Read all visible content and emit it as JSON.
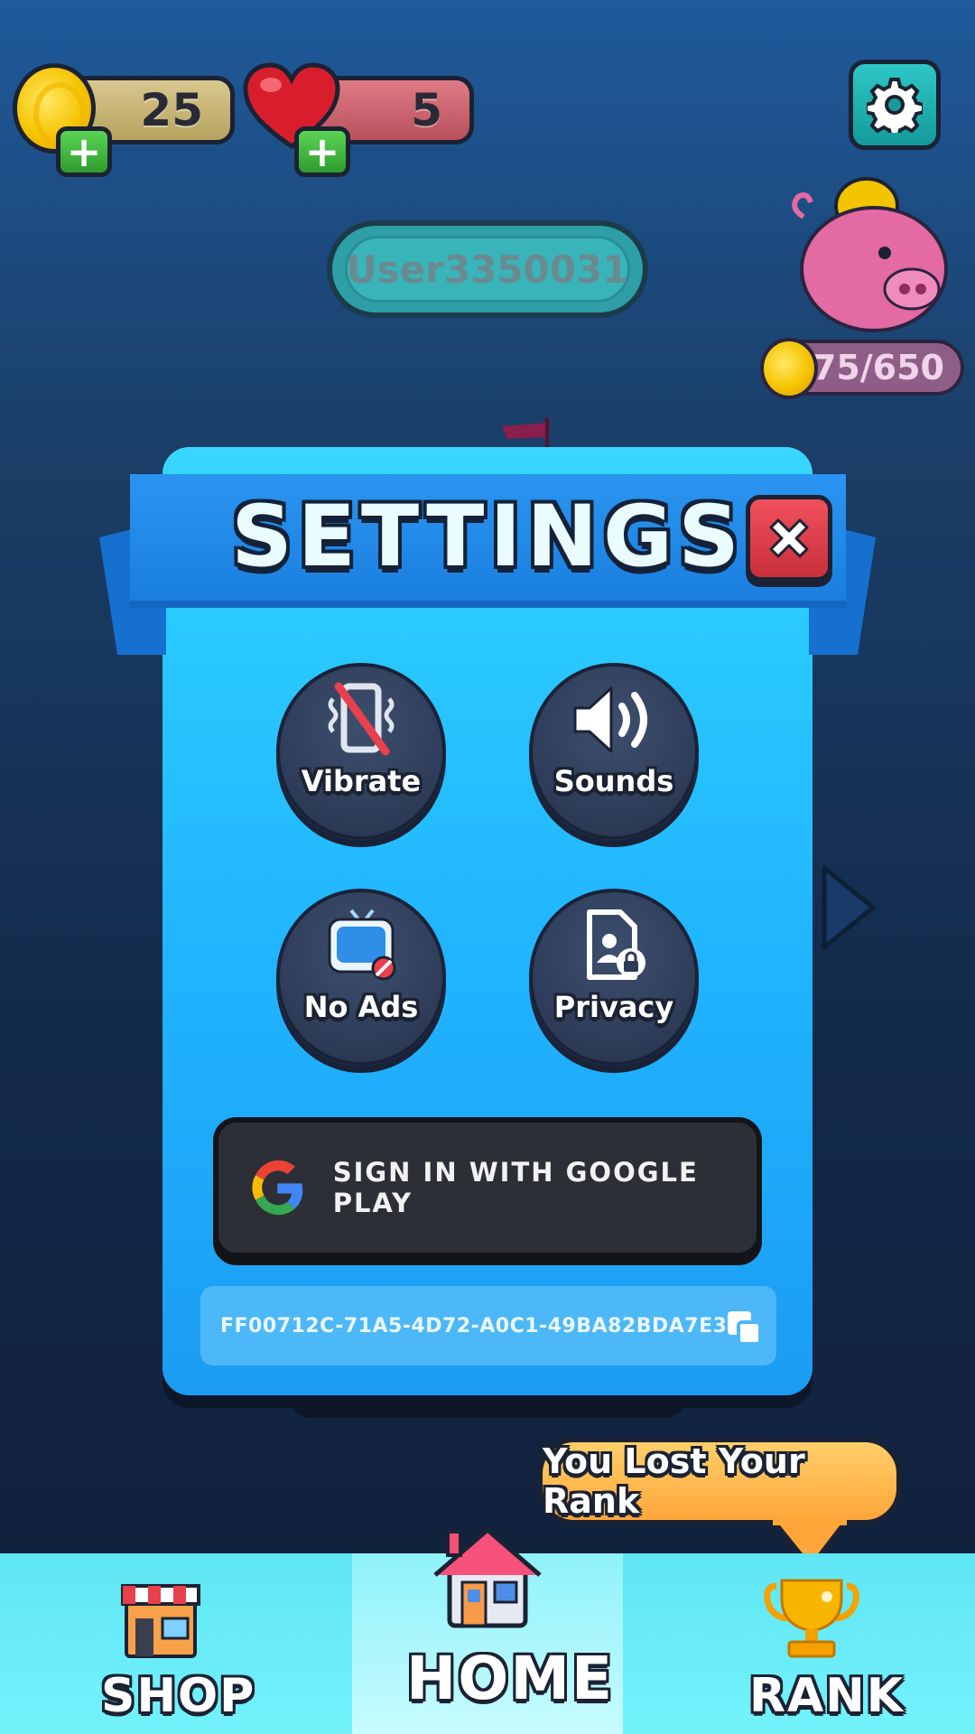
{
  "hud": {
    "coins": "25",
    "lives": "5",
    "username": "User3350031",
    "piggy_bank": "375/650"
  },
  "settings": {
    "title": "SETTINGS",
    "options": [
      {
        "label": "Vibrate",
        "icon": "vibrate-off-icon"
      },
      {
        "label": "Sounds",
        "icon": "speaker-icon"
      },
      {
        "label": "No Ads",
        "icon": "no-ads-tv-icon"
      },
      {
        "label": "Privacy",
        "icon": "privacy-document-lock-icon"
      }
    ],
    "google_button": "SIGN IN WITH GOOGLE PLAY",
    "user_id": "FF00712C-71A5-4D72-A0C1-49BA82BDA7E3"
  },
  "tooltip": "You Lost Your Rank",
  "nav": {
    "shop": "SHOP",
    "home": "HOME",
    "rank": "RANK"
  },
  "colors": {
    "modal": "#20b4ff",
    "ribbon": "#1a7fe0",
    "close": "#e0404c",
    "nav": "#6aeef8",
    "tooltip": "#ffb84a"
  }
}
